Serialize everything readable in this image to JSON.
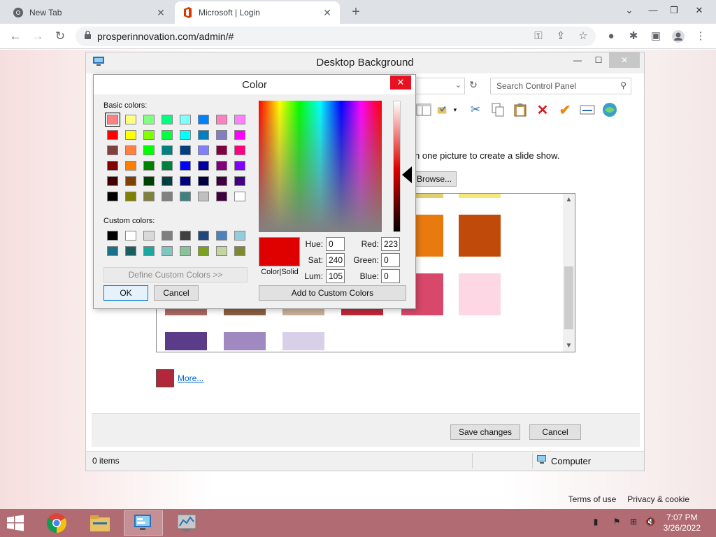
{
  "browser": {
    "tabs": [
      {
        "title": "New Tab"
      },
      {
        "title": "Microsoft | Login"
      }
    ],
    "url": "prosperinnovation.com/admin/#"
  },
  "window": {
    "title": "Desktop Background",
    "search_placeholder": "Search Control Panel",
    "instruction": "n one picture to create a slide show.",
    "browse_label": "Browse...",
    "more_label": "More...",
    "save_label": "Save changes",
    "cancel_label": "Cancel",
    "status_items": "0 items",
    "status_location": "Computer",
    "swatch_colors": [
      "#e0d070",
      "#f5e878",
      "#e87a10",
      "#c04a0a",
      "#a86860",
      "#8a6040",
      "#c8b098",
      "#c02838",
      "#d8486a",
      "#fdd8e4",
      "#5a3c88",
      "#a088c0",
      "#d8d0e8"
    ],
    "more_color": "#b0283a"
  },
  "color_dialog": {
    "title": "Color",
    "basic_label": "Basic colors:",
    "custom_label": "Custom colors:",
    "define_label": "Define Custom Colors >>",
    "ok_label": "OK",
    "cancel_label": "Cancel",
    "add_label": "Add to Custom Colors",
    "color_solid_label": "Color|Solid",
    "fields": {
      "hue_label": "Hue:",
      "hue": "0",
      "sat_label": "Sat:",
      "sat": "240",
      "lum_label": "Lum:",
      "lum": "105",
      "red_label": "Red:",
      "red": "223",
      "green_label": "Green:",
      "green": "0",
      "blue_label": "Blue:",
      "blue": "0"
    },
    "current_color": "#df0000",
    "basic_colors": [
      "#ff8080",
      "#ffff80",
      "#80ff80",
      "#00ff80",
      "#80ffff",
      "#0080ff",
      "#ff80c0",
      "#ff80ff",
      "#ff0000",
      "#ffff00",
      "#80ff00",
      "#00ff40",
      "#00ffff",
      "#0080c0",
      "#8080c0",
      "#ff00ff",
      "#804040",
      "#ff8040",
      "#00ff00",
      "#008080",
      "#004080",
      "#8080ff",
      "#800040",
      "#ff0080",
      "#800000",
      "#ff8000",
      "#008000",
      "#008040",
      "#0000ff",
      "#0000a0",
      "#800080",
      "#8000ff",
      "#400000",
      "#804000",
      "#004000",
      "#004040",
      "#000080",
      "#000040",
      "#400040",
      "#400080",
      "#000000",
      "#808000",
      "#808040",
      "#808080",
      "#408080",
      "#c0c0c0",
      "#400040",
      "#ffffff"
    ],
    "custom_colors": [
      "#000000",
      "#ffffff",
      "#d9d9d9",
      "#7f7f7f",
      "#404040",
      "#1f497d",
      "#4f81bd",
      "#92cddc",
      "#17728a",
      "#195f5f",
      "#1ba8a0",
      "#7fc6c0",
      "#8ac29a",
      "#7ba21e",
      "#c4d6a0",
      "#7f8a30"
    ]
  },
  "page": {
    "terms": "Terms of use",
    "privacy": "Privacy & cookie"
  },
  "taskbar": {
    "time": "7:07 PM",
    "date": "3/26/2022"
  }
}
